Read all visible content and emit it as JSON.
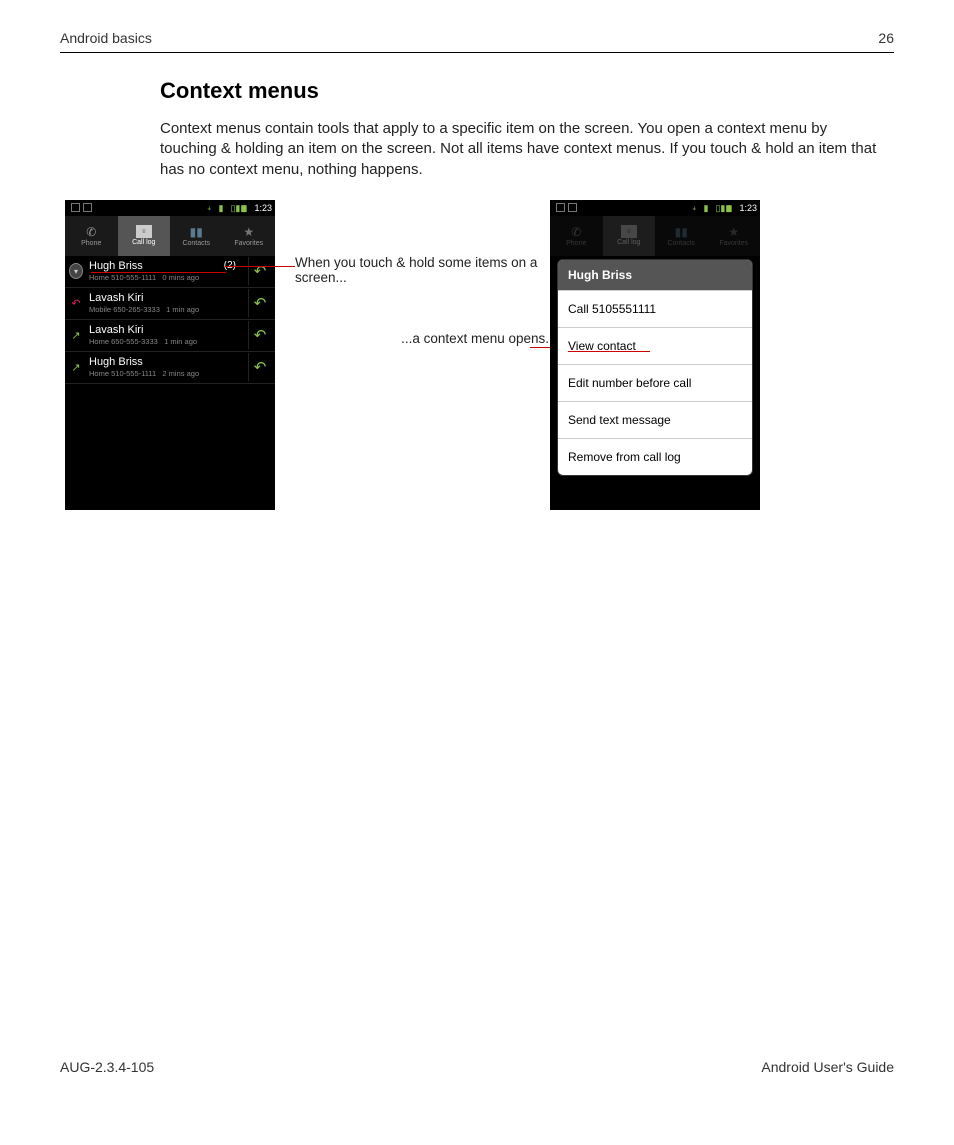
{
  "header": {
    "section": "Android basics",
    "page": "26"
  },
  "title": "Context menus",
  "intro": "Context menus contain tools that apply to a specific item on the screen. You open a context menu by touching & holding an item on the screen. Not all items have context menus. If you touch & hold an item that has no context menu, nothing happens.",
  "statusbar": {
    "time": "1:23"
  },
  "tabs": {
    "phone": "Phone",
    "calllog": "Call log",
    "contacts": "Contacts",
    "favorites": "Favorites"
  },
  "callLog": [
    {
      "name": "Hugh Briss",
      "count": "(2)",
      "subLabel": "Home",
      "subNumber": "510-555-1111",
      "subTime": "0 mins ago",
      "type": "group"
    },
    {
      "name": "Lavash Kiri",
      "count": "",
      "subLabel": "Mobile",
      "subNumber": "650-265-3333",
      "subTime": "1 min ago",
      "type": "missed"
    },
    {
      "name": "Lavash Kiri",
      "count": "",
      "subLabel": "Home",
      "subNumber": "650-555-3333",
      "subTime": "1 min ago",
      "type": "outgoing"
    },
    {
      "name": "Hugh Briss",
      "count": "",
      "subLabel": "Home",
      "subNumber": "510-555-1111",
      "subTime": "2 mins ago",
      "type": "outgoing"
    }
  ],
  "annotations": {
    "touchHold": "When you touch & hold some items on a screen...",
    "opens": "...a context menu opens."
  },
  "contextMenu": {
    "title": "Hugh Briss",
    "items": [
      "Call 5105551111",
      "View contact",
      "Edit number before call",
      "Send text message",
      "Remove from call log"
    ]
  },
  "footer": {
    "left": "AUG-2.3.4-105",
    "right": "Android User's Guide"
  }
}
